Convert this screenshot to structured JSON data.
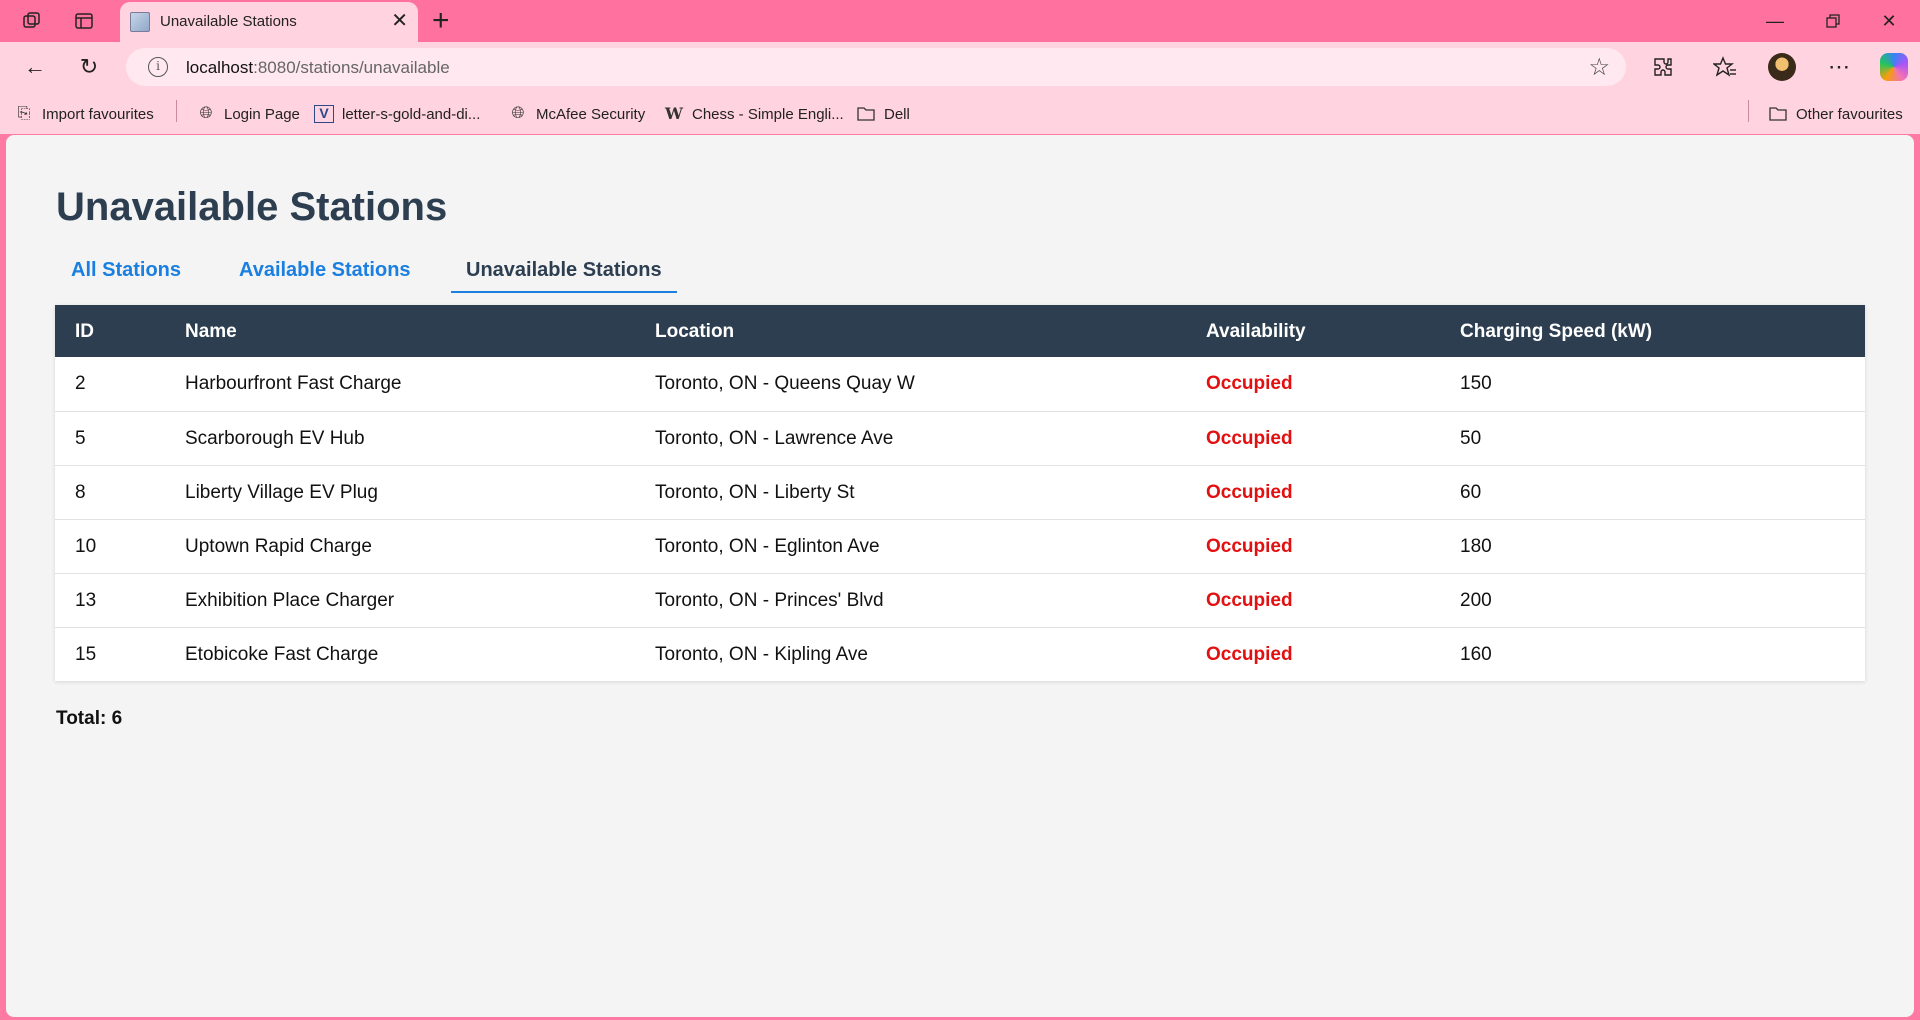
{
  "browser": {
    "tab_title": "Unavailable Stations",
    "url_host": "localhost",
    "url_rest": ":8080/stations/unavailable",
    "bookmarks": [
      {
        "label": "Import favourites",
        "icon": "import-icon"
      },
      {
        "label": "Login Page",
        "icon": "globe-icon"
      },
      {
        "label": "letter-s-gold-and-di...",
        "icon": "v-logo-icon"
      },
      {
        "label": "McAfee Security",
        "icon": "globe-icon"
      },
      {
        "label": "Chess - Simple Engli...",
        "icon": "wikipedia-icon"
      },
      {
        "label": "Dell",
        "icon": "folder-icon"
      }
    ],
    "other_favourites": "Other favourites"
  },
  "page": {
    "title": "Unavailable Stations",
    "nav": [
      {
        "label": "All Stations"
      },
      {
        "label": "Available Stations"
      },
      {
        "label": "Unavailable Stations"
      }
    ],
    "active_nav": "Unavailable Stations",
    "columns": [
      "ID",
      "Name",
      "Location",
      "Availability",
      "Charging Speed (kW)"
    ],
    "rows": [
      {
        "id": "2",
        "name": "Harbourfront Fast Charge",
        "location": "Toronto, ON - Queens Quay W",
        "availability": "Occupied",
        "speed": "150"
      },
      {
        "id": "5",
        "name": "Scarborough EV Hub",
        "location": "Toronto, ON - Lawrence Ave",
        "availability": "Occupied",
        "speed": "50"
      },
      {
        "id": "8",
        "name": "Liberty Village EV Plug",
        "location": "Toronto, ON - Liberty St",
        "availability": "Occupied",
        "speed": "60"
      },
      {
        "id": "10",
        "name": "Uptown Rapid Charge",
        "location": "Toronto, ON - Eglinton Ave",
        "availability": "Occupied",
        "speed": "180"
      },
      {
        "id": "13",
        "name": "Exhibition Place Charger",
        "location": "Toronto, ON - Princes' Blvd",
        "availability": "Occupied",
        "speed": "200"
      },
      {
        "id": "15",
        "name": "Etobicoke Fast Charge",
        "location": "Toronto, ON - Kipling Ave",
        "availability": "Occupied",
        "speed": "160"
      }
    ],
    "total": "Total: 6"
  },
  "colors": {
    "header_bg": "#2c3e50",
    "link": "#1a7fe0",
    "occupied": "#e21010"
  }
}
